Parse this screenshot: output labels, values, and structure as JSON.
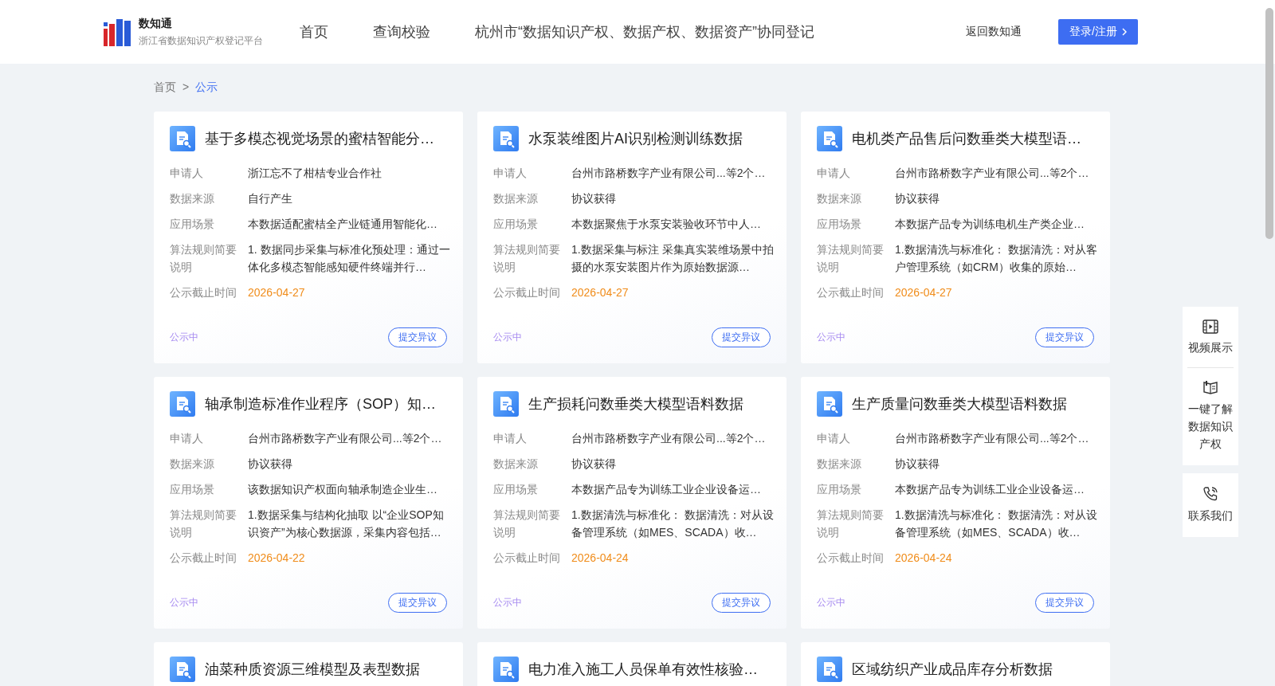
{
  "header": {
    "logo_title": "数知通",
    "logo_subtitle": "浙江省数据知识产权登记平台",
    "nav": [
      {
        "label": "首页",
        "selected": false
      },
      {
        "label": "查询校验",
        "selected": false
      },
      {
        "label": "杭州市“数据知识产权、数据产权、数据资产”协同登记",
        "selected": false
      }
    ],
    "back_link": "返回数知通",
    "login_button": "登录/注册"
  },
  "breadcrumb": {
    "separator": ">",
    "items": [
      {
        "label": "首页",
        "selected": false
      },
      {
        "label": "公示",
        "selected": true
      }
    ]
  },
  "cards": [
    {
      "title": "基于多模态视觉场景的蜜桔智能分…",
      "fields": [
        {
          "label": "申请人",
          "value": "浙江忘不了柑桔专业合作社"
        },
        {
          "label": "数据来源",
          "value": "自行产生"
        },
        {
          "label": "应用场景",
          "value": "本数据适配蜜桔全产业链通用智能化…"
        },
        {
          "label": "算法规则简要说明",
          "value": "1. 数据同步采集与标准化预处理：通过一体化多模态智能感知硬件终端并行…"
        },
        {
          "label": "公示截止时间",
          "value": "2026-04-27",
          "kind": "date"
        }
      ],
      "status": "公示中",
      "action": "提交异议"
    },
    {
      "title": "水泵装维图片AI识别检测训练数据",
      "fields": [
        {
          "label": "申请人",
          "value": "台州市路桥数字产业有限公司...等2个…"
        },
        {
          "label": "数据来源",
          "value": "协议获得"
        },
        {
          "label": "应用场景",
          "value": "本数据聚焦于水泵安装验收环节中人…"
        },
        {
          "label": "算法规则简要说明",
          "value": "1.数据采集与标注 采集真实装维场景中拍摄的水泵安装图片作为原始数据源…"
        },
        {
          "label": "公示截止时间",
          "value": "2026-04-27",
          "kind": "date"
        }
      ],
      "status": "公示中",
      "action": "提交异议"
    },
    {
      "title": "电机类产品售后问数垂类大模型语…",
      "fields": [
        {
          "label": "申请人",
          "value": "台州市路桥数字产业有限公司...等2个…"
        },
        {
          "label": "数据来源",
          "value": "协议获得"
        },
        {
          "label": "应用场景",
          "value": "本数据产品专为训练电机生产类企业…"
        },
        {
          "label": "算法规则简要说明",
          "value": "1.数据清洗与标准化： 数据清洗：对从客户管理系统（如CRM）收集的原始…"
        },
        {
          "label": "公示截止时间",
          "value": "2026-04-27",
          "kind": "date"
        }
      ],
      "status": "公示中",
      "action": "提交异议"
    },
    {
      "title": "轴承制造标准作业程序（SOP）知…",
      "fields": [
        {
          "label": "申请人",
          "value": "台州市路桥数字产业有限公司...等2个…"
        },
        {
          "label": "数据来源",
          "value": "协议获得"
        },
        {
          "label": "应用场景",
          "value": "该数据知识产权面向轴承制造企业生…"
        },
        {
          "label": "算法规则简要说明",
          "value": "1.数据采集与结构化抽取 以“企业SOP知识资产”为核心数据源，采集内容包括…"
        },
        {
          "label": "公示截止时间",
          "value": "2026-04-22",
          "kind": "date"
        }
      ],
      "status": "公示中",
      "action": "提交异议"
    },
    {
      "title": "生产损耗问数垂类大模型语料数据",
      "fields": [
        {
          "label": "申请人",
          "value": "台州市路桥数字产业有限公司...等2个…"
        },
        {
          "label": "数据来源",
          "value": "协议获得"
        },
        {
          "label": "应用场景",
          "value": "本数据产品专为训练工业企业设备运…"
        },
        {
          "label": "算法规则简要说明",
          "value": "1.数据清洗与标准化： 数据清洗：对从设备管理系统（如MES、SCADA）收…"
        },
        {
          "label": "公示截止时间",
          "value": "2026-04-24",
          "kind": "date"
        }
      ],
      "status": "公示中",
      "action": "提交异议"
    },
    {
      "title": "生产质量问数垂类大模型语料数据",
      "fields": [
        {
          "label": "申请人",
          "value": "台州市路桥数字产业有限公司...等2个…"
        },
        {
          "label": "数据来源",
          "value": "协议获得"
        },
        {
          "label": "应用场景",
          "value": "本数据产品专为训练工业企业设备运…"
        },
        {
          "label": "算法规则简要说明",
          "value": "1.数据清洗与标准化： 数据清洗：对从设备管理系统（如MES、SCADA）收…"
        },
        {
          "label": "公示截止时间",
          "value": "2026-04-24",
          "kind": "date"
        }
      ],
      "status": "公示中",
      "action": "提交异议"
    },
    {
      "title": "油菜种质资源三维模型及表型数据"
    },
    {
      "title": "电力准入施工人员保单有效性核验…"
    },
    {
      "title": "区域纺织产业成品库存分析数据"
    }
  ],
  "side_panel": [
    {
      "label": "视频展示",
      "kind": "video"
    },
    {
      "label": "一键了解数据知识产权",
      "kind": "book"
    },
    {
      "label": "联系我们",
      "kind": "phone"
    }
  ]
}
